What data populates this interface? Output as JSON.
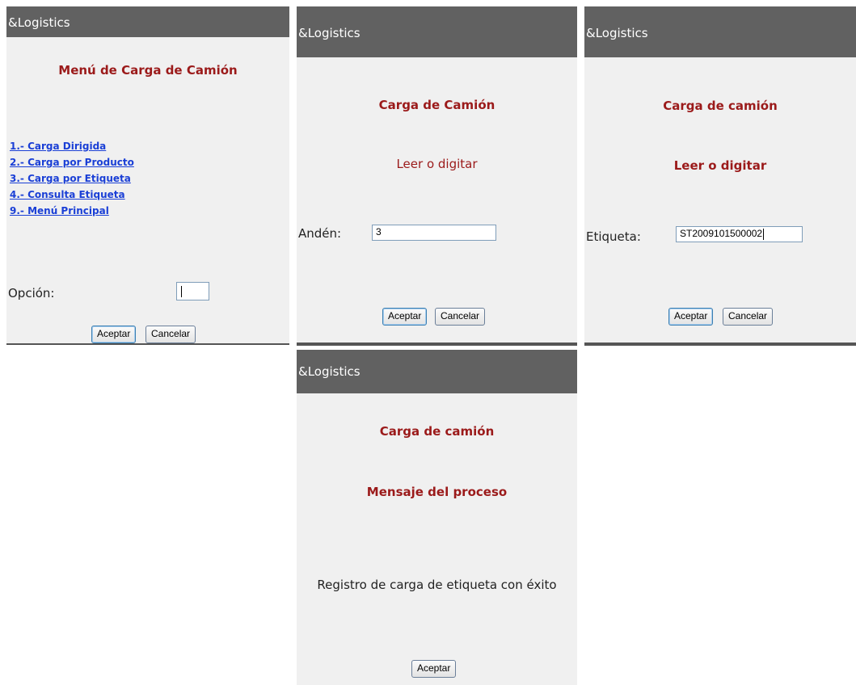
{
  "app_title": "&Logistics",
  "screen1": {
    "title": "Menú de Carga de Camión",
    "menu_items": [
      {
        "label": "1.- Carga Dirigida"
      },
      {
        "label": "2.- Carga por Producto"
      },
      {
        "label": "3.- Carga por Etiqueta"
      },
      {
        "label": "4.- Consulta Etiqueta"
      },
      {
        "label": "9.- Menú Principal"
      }
    ],
    "option_label": "Opción:",
    "option_value": "",
    "accept_label": "Aceptar",
    "cancel_label": "Cancelar"
  },
  "screen2": {
    "title": "Carga de Camión",
    "subtitle": "Leer o digitar",
    "field_label": "Andén:",
    "field_value": "3",
    "accept_label": "Aceptar",
    "cancel_label": "Cancelar"
  },
  "screen3": {
    "title": "Carga de camión",
    "subtitle": "Leer o digitar",
    "field_label": "Etiqueta:",
    "field_value": "ST2009101500002",
    "accept_label": "Aceptar",
    "cancel_label": "Cancelar"
  },
  "screen4": {
    "title": "Carga de camión",
    "subtitle": "Mensaje del proceso",
    "message": "Registro de carga de etiqueta con éxito",
    "accept_label": "Aceptar"
  },
  "colors": {
    "titlebar": "#616161",
    "panel": "#f0f0f0",
    "heading": "#9b1a1a",
    "link": "#1a3fd6"
  }
}
